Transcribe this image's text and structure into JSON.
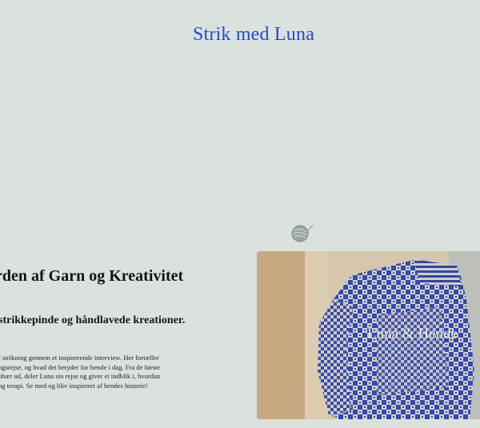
{
  "site": {
    "title": "Strik med Luna"
  },
  "hero": {
    "heading": "rden af Garn og Kreativitet",
    "subheading": "strikkepinde og håndlavede kreationer.",
    "body_lines": [
      "f strikning gennem et inspirerende interview. Her fortæller",
      "ngsrejse, og hvad det betyder for hende i dag. Fra de første",
      "nbær ud, deler Luna sin rejse og giver et indblik i, hvordan",
      "ng terapi. Se med og bliv inspireret af hendes historie!"
    ]
  },
  "photo": {
    "caption": "Luna & Hende"
  },
  "icons": {
    "yarn": "yarn-ball-icon"
  },
  "colors": {
    "background": "#dbe2dd",
    "title": "#1d49e0",
    "sweater_blue": "#2f4fc8"
  }
}
